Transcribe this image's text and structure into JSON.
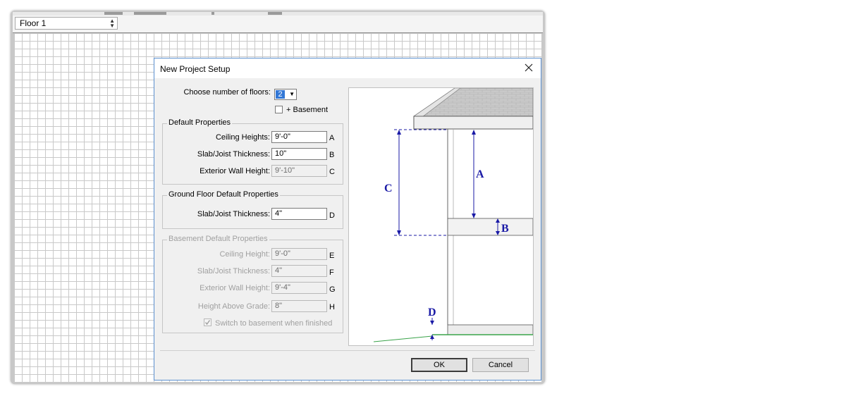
{
  "floor_selector": {
    "value": "Floor 1"
  },
  "dialog": {
    "title": "New Project Setup",
    "floors_label": "Choose number of floors:",
    "floors_value": "2",
    "basement_label": "+ Basement",
    "basement_checked": false,
    "default_group": {
      "title": "Default Properties",
      "rows": [
        {
          "label": "Ceiling Heights:",
          "value": "9'-0\"",
          "letter": "A"
        },
        {
          "label": "Slab/Joist Thickness:",
          "value": "10\"",
          "letter": "B"
        },
        {
          "label": "Exterior Wall Height:",
          "value": "9'-10\"",
          "letter": "C"
        }
      ]
    },
    "ground_group": {
      "title": "Ground Floor Default Properties",
      "rows": [
        {
          "label": "Slab/Joist Thickness:",
          "value": "4\"",
          "letter": "D"
        }
      ]
    },
    "basement_group": {
      "title": "Basement Default Properties",
      "rows": [
        {
          "label": "Ceiling Height:",
          "value": "9'-0\"",
          "letter": "E"
        },
        {
          "label": "Slab/Joist Thickness:",
          "value": "4\"",
          "letter": "F"
        },
        {
          "label": "Exterior Wall Height:",
          "value": "9'-4\"",
          "letter": "G"
        },
        {
          "label": "Height Above Grade:",
          "value": "8\"",
          "letter": "H"
        }
      ],
      "switch_label": "Switch to basement when finished",
      "switch_checked": true
    },
    "ok_label": "OK",
    "cancel_label": "Cancel"
  },
  "diagram": {
    "labels": {
      "a": "A",
      "b": "B",
      "c": "C",
      "d": "D"
    },
    "dim_color": "#1a1aa6",
    "grade_color": "#3aa34a"
  }
}
